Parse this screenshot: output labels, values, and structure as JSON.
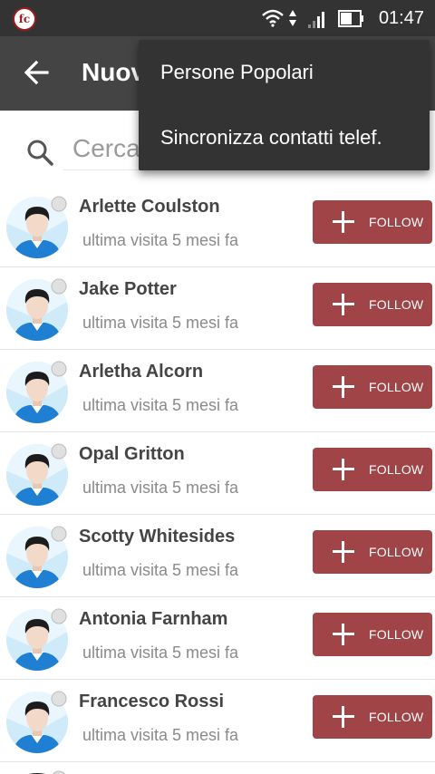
{
  "status_bar": {
    "app_icon_label": "fc",
    "icons": [
      "wifi-icon",
      "data-arrows-icon",
      "signal-icon",
      "battery-icon"
    ],
    "time": "01:47"
  },
  "app_bar": {
    "back_icon": "arrow-back-icon",
    "title": "Nuov"
  },
  "search": {
    "icon": "search-icon",
    "placeholder": "Cerca"
  },
  "users": [
    {
      "name": "Arlette Coulston",
      "last_seen": "ultima visita 5 mesi fa",
      "button_label": "FOLLOW"
    },
    {
      "name": "Jake Potter",
      "last_seen": "ultima visita 5 mesi fa",
      "button_label": "FOLLOW"
    },
    {
      "name": "Arletha Alcorn",
      "last_seen": "ultima visita 5 mesi fa",
      "button_label": "FOLLOW"
    },
    {
      "name": "Opal Gritton",
      "last_seen": "ultima visita 5 mesi fa",
      "button_label": "FOLLOW"
    },
    {
      "name": "Scotty Whitesides",
      "last_seen": "ultima visita 5 mesi fa",
      "button_label": "FOLLOW"
    },
    {
      "name": "Antonia Farnham",
      "last_seen": "ultima visita 5 mesi fa",
      "button_label": "FOLLOW"
    },
    {
      "name": "Francesco Rossi",
      "last_seen": "ultima visita 5 mesi fa",
      "button_label": "FOLLOW"
    }
  ],
  "overflow_menu": {
    "items": [
      {
        "label": "Persone Popolari"
      },
      {
        "label": "Sincronizza contatti telef."
      }
    ]
  },
  "colors": {
    "status_bar_bg": "#333333",
    "app_bar_bg": "#444444",
    "follow_button_bg": "#a04448",
    "menu_bg": "#333333"
  }
}
